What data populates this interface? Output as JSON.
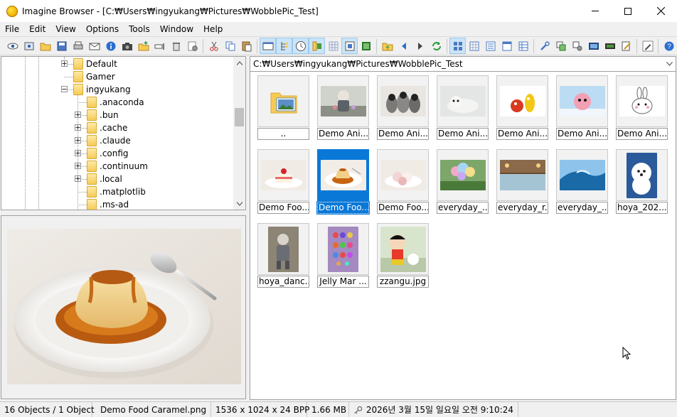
{
  "window": {
    "title": "Imagine Browser - [C:₩Users₩ingyukang₩Pictures₩WobblePic_Test]"
  },
  "menu": [
    "File",
    "Edit",
    "View",
    "Options",
    "Tools",
    "Window",
    "Help"
  ],
  "tree": {
    "items": [
      {
        "label": "Default",
        "expander": "plus"
      },
      {
        "label": "Gamer",
        "expander": "none"
      },
      {
        "label": "ingyukang",
        "expander": "minus"
      },
      {
        "label": ".anaconda",
        "expander": "none"
      },
      {
        "label": ".bun",
        "expander": "plus"
      },
      {
        "label": ".cache",
        "expander": "plus"
      },
      {
        "label": ".claude",
        "expander": "plus"
      },
      {
        "label": ".config",
        "expander": "plus"
      },
      {
        "label": ".continuum",
        "expander": "plus"
      },
      {
        "label": ".local",
        "expander": "plus"
      },
      {
        "label": ".matplotlib",
        "expander": "none"
      },
      {
        "label": ".ms-ad",
        "expander": "none"
      }
    ]
  },
  "path": "C:₩Users₩ingyukang₩Pictures₩WobblePic_Test",
  "thumbnails": [
    {
      "label": "..",
      "kind": "folder"
    },
    {
      "label": "Demo Ani...",
      "kind": "bear"
    },
    {
      "label": "Demo Ani...",
      "kind": "penguins"
    },
    {
      "label": "Demo Ani...",
      "kind": "seal"
    },
    {
      "label": "Demo Ani...",
      "kind": "larva"
    },
    {
      "label": "Demo Ani...",
      "kind": "pink"
    },
    {
      "label": "Demo Ani...",
      "kind": "bunny"
    },
    {
      "label": "Demo Foo...",
      "kind": "cake"
    },
    {
      "label": "Demo Foo...",
      "kind": "pudding",
      "selected": true
    },
    {
      "label": "Demo Foo...",
      "kind": "mochi"
    },
    {
      "label": "everyday_...",
      "kind": "balloons"
    },
    {
      "label": "everyday_r...",
      "kind": "pool"
    },
    {
      "label": "everyday_...",
      "kind": "wave"
    },
    {
      "label": "hoya_202...",
      "kind": "dog"
    },
    {
      "label": "hoya_danc...",
      "kind": "bear2"
    },
    {
      "label": "Jelly Mar ...",
      "kind": "jelly"
    },
    {
      "label": "zzangu.jpg",
      "kind": "shin"
    }
  ],
  "status": {
    "objects": "16 Objects / 1 Object",
    "filename": "Demo Food Caramel.png",
    "dimensions": "1536 x 1024 x 24 BPP",
    "size": "1.66 MB",
    "date": "2026년 3월 15일 일요일 오전 9:10:24"
  },
  "colors": {
    "selection": "#0a78d7",
    "toolbar_active": "#cce4f7"
  }
}
